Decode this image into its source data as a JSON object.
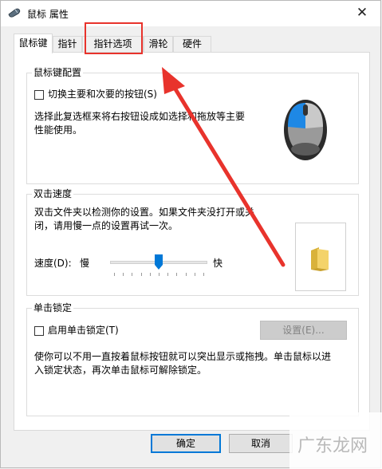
{
  "window": {
    "title": "鼠标 属性",
    "close_glyph": "✕"
  },
  "tabs": [
    {
      "label": "鼠标键",
      "active": true
    },
    {
      "label": "指针",
      "active": false
    },
    {
      "label": "指针选项",
      "active": false
    },
    {
      "label": "滑轮",
      "active": false
    },
    {
      "label": "硬件",
      "active": false
    }
  ],
  "button_config": {
    "title": "鼠标键配置",
    "checkbox_label": "切换主要和次要的按钮(S)",
    "checked": false,
    "desc_line1": "选择此复选框来将右按钮设成如选择和拖放等主要",
    "desc_line2": "性能使用。"
  },
  "double_click": {
    "title": "双击速度",
    "desc_line1": "双击文件夹以检测你的设置。如果文件夹没打开或关",
    "desc_line2": "闭，请用慢一点的设置再试一次。",
    "speed_label": "速度(D):",
    "slow_label": "慢",
    "fast_label": "快",
    "speed_fraction": 0.5
  },
  "click_lock": {
    "title": "单击锁定",
    "checkbox_label": "启用单击锁定(T)",
    "checked": false,
    "settings_button": "设置(E)...",
    "desc_line1": "使你可以不用一直按着鼠标按钮就可以突出显示或拖拽。单击鼠标以进",
    "desc_line2": "入锁定状态，再次单击鼠标可解除锁定。"
  },
  "footer": {
    "ok": "确定",
    "cancel": "取消"
  },
  "watermark": {
    "text": "广东龙网"
  },
  "colors": {
    "accent": "#0078d7",
    "annotation_red": "#e8332c",
    "mouse_highlight": "#1e88e5"
  },
  "icons": [
    "mouse-cursor-icon",
    "close-icon",
    "mouse-icon",
    "folder-icon",
    "slider-thumb-icon"
  ]
}
